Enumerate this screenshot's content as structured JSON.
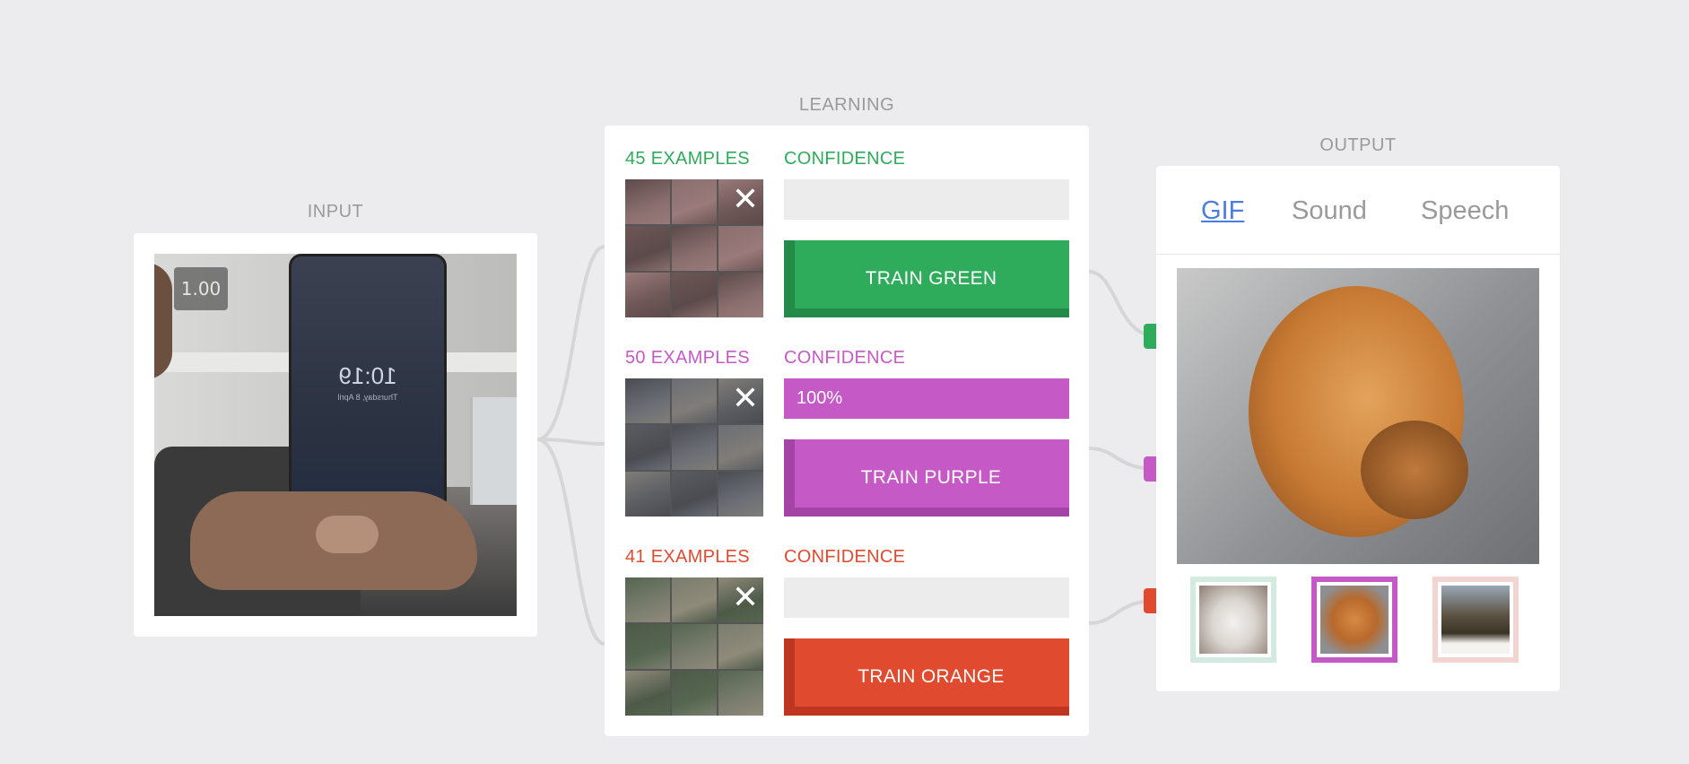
{
  "sections": {
    "input": "INPUT",
    "learning": "LEARNING",
    "output": "OUTPUT"
  },
  "input": {
    "score": "1.00",
    "phone_time": "10:19",
    "phone_date": "Thursday, 8 April"
  },
  "classes": [
    {
      "id": "green",
      "examples": "45 EXAMPLES",
      "confidence_label": "CONFIDENCE",
      "confidence_text": "",
      "confidence": 0,
      "train_label": "TRAIN GREEN",
      "color": "#2eab5b",
      "dark": "#238a48",
      "clear": "✕"
    },
    {
      "id": "purple",
      "examples": "50 EXAMPLES",
      "confidence_label": "CONFIDENCE",
      "confidence_text": "100%",
      "confidence": 1.0,
      "train_label": "TRAIN PURPLE",
      "color": "#c55ac6",
      "dark": "#a444a6",
      "clear": "✕"
    },
    {
      "id": "orange",
      "examples": "41 EXAMPLES",
      "confidence_label": "CONFIDENCE",
      "confidence_text": "",
      "confidence": 0,
      "train_label": "TRAIN ORANGE",
      "color": "#e04a2f",
      "dark": "#bf3620",
      "clear": "✕"
    }
  ],
  "output": {
    "tabs": [
      {
        "label": "GIF",
        "active": true
      },
      {
        "label": "Sound",
        "active": false
      },
      {
        "label": "Speech",
        "active": false
      }
    ],
    "thumbs": [
      {
        "name": "cat-gif-thumb",
        "border": "#d3ebde",
        "selected": false
      },
      {
        "name": "dog-gif-thumb",
        "border": "#c55ac6",
        "selected": true
      },
      {
        "name": "bunny-gif-thumb",
        "border": "#f2d5d1",
        "selected": false
      }
    ]
  }
}
